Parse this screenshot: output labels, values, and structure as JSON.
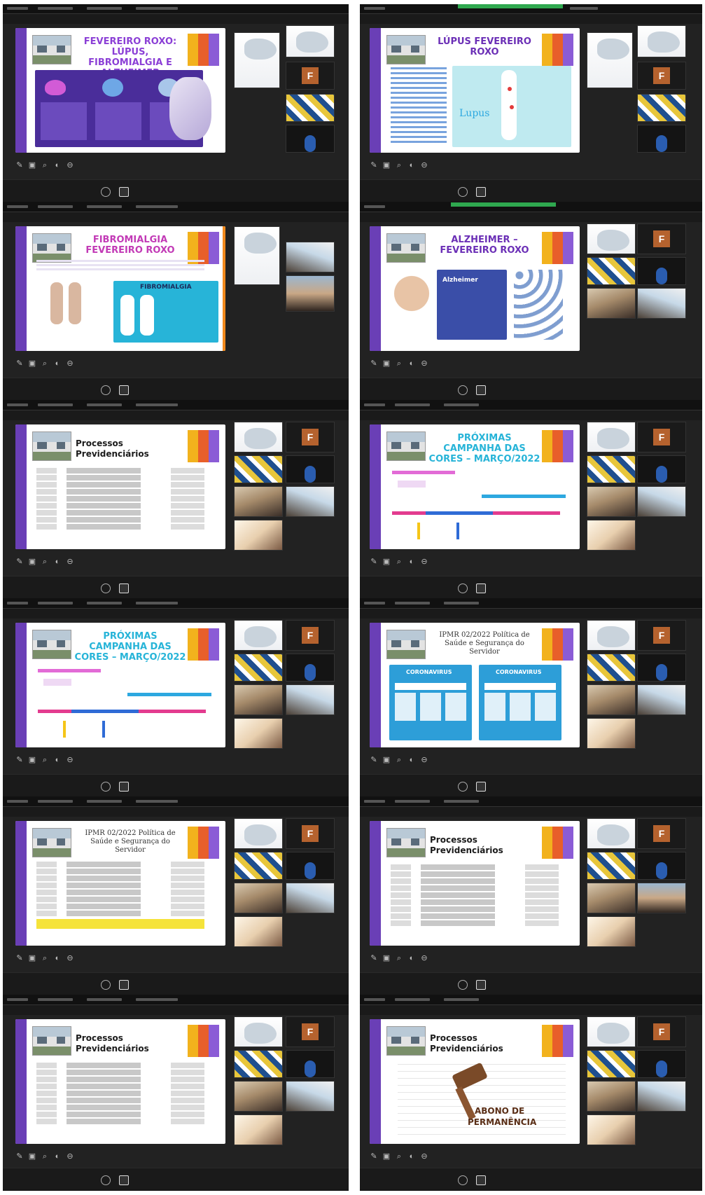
{
  "tiles_letter": "F",
  "slides": {
    "s1": {
      "title": "FEVEREIRO ROXO: LÚPUS, FIBROMIALGIA E ALZHEIMER"
    },
    "s2": {
      "title": "LÚPUS FEVEREIRO ROXO",
      "sub": "Lupus"
    },
    "s3": {
      "title": "FIBROMIALGIA FEVEREIRO ROXO",
      "box": "FIBROMIALGIA"
    },
    "s4": {
      "title": "ALZHEIMER – FEVEREIRO ROXO",
      "box": "Alzheimer"
    },
    "s5": {
      "title": "Processos Previdenciários"
    },
    "s6": {
      "title": "PRÓXIMAS CAMPANHA DAS CORES – MARÇO/2022"
    },
    "s7": {
      "title": "PRÓXIMAS CAMPANHA DAS CORES – MARÇO/2022"
    },
    "s8": {
      "title": "IPMR 02/2022 Política de Saúde e Segurança do Servidor",
      "box": "CORONAVIRUS"
    },
    "s9": {
      "title": "IPMR 02/2022 Política de Saúde e Segurança do Servidor"
    },
    "s10": {
      "title": "Processos Previdenciários"
    },
    "s11": {
      "title": "Processos Previdenciários"
    },
    "s12": {
      "title": "Processos Previdenciários",
      "stamp_line1": "ABONO DE",
      "stamp_line2": "PERMANÊNCIA"
    }
  },
  "colors": {
    "purple": "#6a3fb6",
    "orange": "#f28a1d",
    "cyan": "#27b4d8"
  }
}
